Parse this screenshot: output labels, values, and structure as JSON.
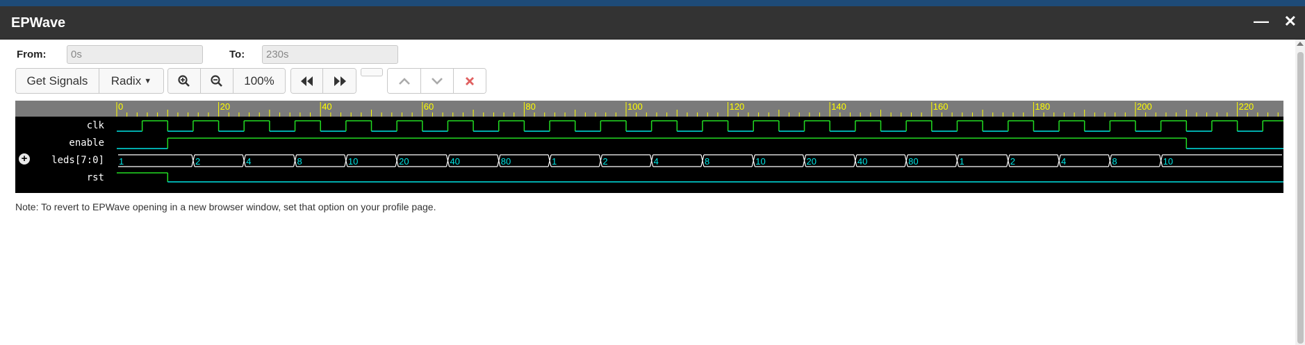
{
  "window": {
    "title": "EPWave",
    "minimize_icon": "minimize-icon",
    "close_icon": "close-icon"
  },
  "range": {
    "from_label": "From:",
    "from_value": "0s",
    "to_label": "To:",
    "to_value": "230s"
  },
  "toolbar": {
    "get_signals": "Get Signals",
    "radix": "Radix",
    "zoom_in_icon": "zoom-in-icon",
    "zoom_out_icon": "zoom-out-icon",
    "zoom_level": "100%",
    "prev_icon": "fast-backward-icon",
    "next_icon": "fast-forward-icon",
    "up_icon": "chevron-up-icon",
    "down_icon": "chevron-down-icon",
    "remove_icon": "remove-icon"
  },
  "ruler": {
    "ticks": [
      "0",
      "20",
      "40",
      "60",
      "80",
      "100",
      "120",
      "140",
      "160",
      "180",
      "200",
      "220"
    ]
  },
  "signals": [
    {
      "name": "clk",
      "kind": "clock",
      "period": 10,
      "first_rise": 5
    },
    {
      "name": "enable",
      "kind": "bit",
      "transitions": [
        [
          0,
          0
        ],
        [
          10,
          1
        ],
        [
          210,
          0
        ]
      ]
    },
    {
      "name": "leds[7:0]",
      "kind": "bus",
      "expandable": true,
      "values": [
        "1",
        "2",
        "4",
        "8",
        "10",
        "20",
        "40",
        "80",
        "1",
        "2",
        "4",
        "8",
        "10",
        "20",
        "40",
        "80",
        "1",
        "2",
        "4",
        "8",
        "10"
      ],
      "times": [
        0,
        15,
        25,
        35,
        45,
        55,
        65,
        75,
        85,
        95,
        105,
        115,
        125,
        135,
        145,
        155,
        165,
        175,
        185,
        195,
        205
      ]
    },
    {
      "name": "rst",
      "kind": "bit",
      "transitions": [
        [
          0,
          1
        ],
        [
          10,
          0
        ]
      ]
    }
  ],
  "colors": {
    "high": "#00e5e5",
    "edge": "#22dd22",
    "ruler_text": "#ffff00",
    "background": "#000000"
  },
  "note": "Note: To revert to EPWave opening in a new browser window, set that option on your profile page."
}
